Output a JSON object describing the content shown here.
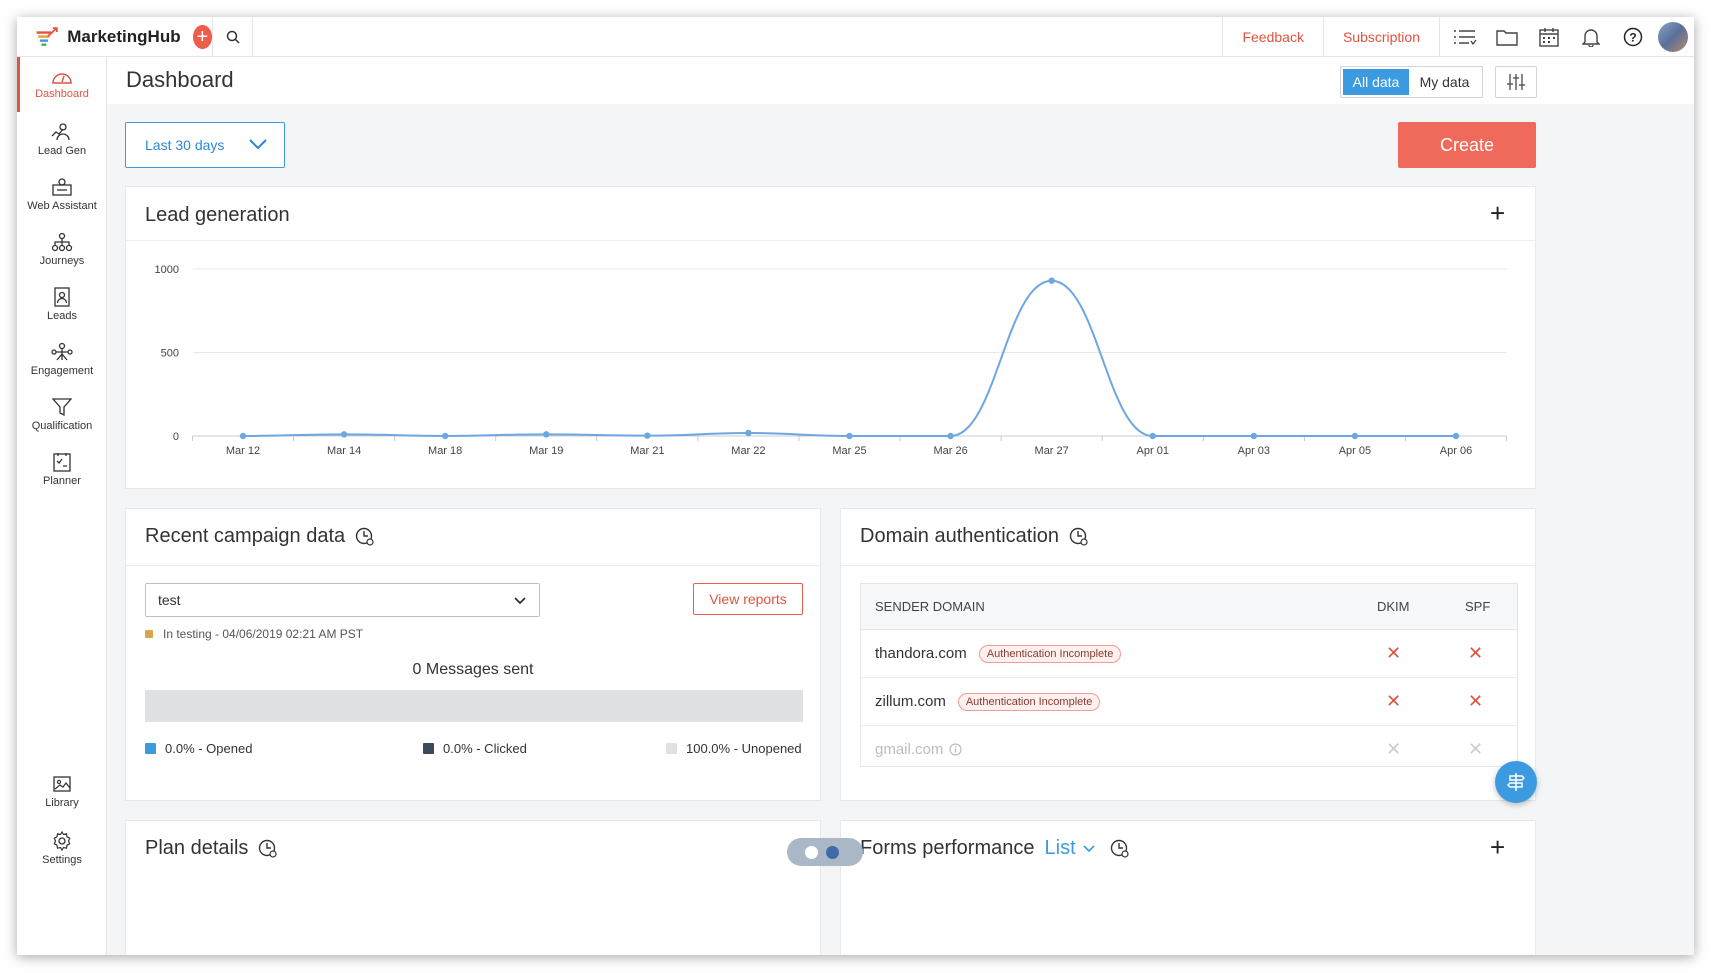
{
  "app": {
    "name": "MarketingHub"
  },
  "topbar": {
    "links": [
      "Feedback",
      "Subscription"
    ],
    "icons": [
      "list-icon",
      "folder-icon",
      "calendar-icon",
      "bell-icon",
      "help-icon"
    ]
  },
  "sidebar": {
    "items": [
      {
        "label": "Dashboard",
        "icon": "dashboard-icon",
        "active": true
      },
      {
        "label": "Lead Gen",
        "icon": "lead-gen-icon"
      },
      {
        "label": "Web Assistant",
        "icon": "web-assistant-icon"
      },
      {
        "label": "Journeys",
        "icon": "journeys-icon"
      },
      {
        "label": "Leads",
        "icon": "leads-icon"
      },
      {
        "label": "Engagement",
        "icon": "engagement-icon"
      },
      {
        "label": "Qualification",
        "icon": "funnel-icon"
      },
      {
        "label": "Planner",
        "icon": "planner-icon"
      }
    ],
    "bottom": [
      {
        "label": "Library",
        "icon": "image-icon"
      },
      {
        "label": "Settings",
        "icon": "gear-icon"
      }
    ]
  },
  "header": {
    "title": "Dashboard",
    "segment": {
      "on": "All data",
      "off": "My data"
    }
  },
  "filter": {
    "date_range": "Last 30 days"
  },
  "create_label": "Create",
  "lead_card": {
    "title": "Lead generation"
  },
  "chart_data": {
    "type": "line",
    "title": "Lead generation",
    "categories": [
      "Mar 12",
      "Mar 14",
      "Mar 18",
      "Mar 19",
      "Mar 21",
      "Mar 22",
      "Mar 25",
      "Mar 26",
      "Mar 27",
      "Apr 01",
      "Apr 03",
      "Apr 05",
      "Apr 06"
    ],
    "series": [
      {
        "values": [
          0,
          10,
          0,
          10,
          2,
          18,
          0,
          0,
          930,
          0,
          0,
          0,
          0
        ]
      }
    ],
    "ylim": [
      0,
      1000
    ],
    "yticks": [
      "1000",
      "500",
      "0"
    ],
    "grid": true,
    "color": "#6ea7e0"
  },
  "campaign": {
    "title": "Recent campaign data",
    "selected": "test",
    "view_reports": "View reports",
    "status": "In testing - 04/06/2019 02:21 AM PST",
    "messages": "0 Messages sent",
    "opened": "0.0% - Opened",
    "clicked": "0.0% - Clicked",
    "unopened": "100.0% - Unopened"
  },
  "domain": {
    "title": "Domain authentication",
    "headers": {
      "domain": "SENDER DOMAIN",
      "dkim": "DKIM",
      "spf": "SPF"
    },
    "rows": [
      {
        "domain": "thandora.com",
        "badge": "Authentication Incomplete"
      },
      {
        "domain": "zillum.com",
        "badge": "Authentication Incomplete"
      },
      {
        "domain": "gmail.com"
      }
    ]
  },
  "plan": {
    "title": "Plan details"
  },
  "forms": {
    "title": "Forms performance",
    "view": "List"
  }
}
